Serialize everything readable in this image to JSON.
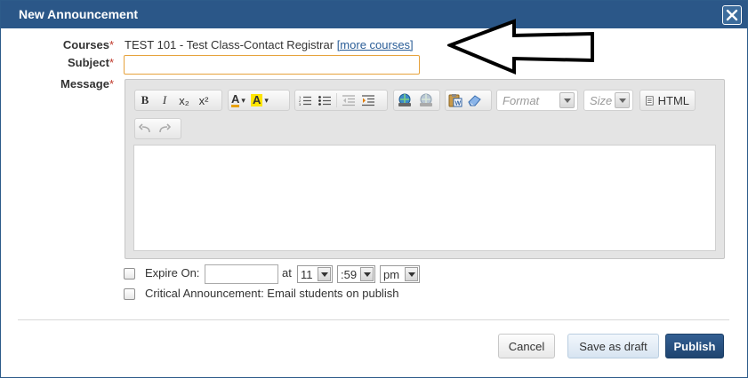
{
  "dialog": {
    "title": "New Announcement",
    "close_icon": "close-icon"
  },
  "form": {
    "courses_label": "Courses",
    "subject_label": "Subject",
    "message_label": "Message",
    "required_mark": "*",
    "courses_value": "TEST 101 - Test Class-Contact Registrar",
    "more_courses_link": "[more courses]",
    "subject_value": ""
  },
  "toolbar": {
    "bold": "B",
    "italic": "I",
    "subscript": "x₂",
    "superscript": "x²",
    "font_color": "A",
    "bg_color": "A",
    "format_placeholder": "Format",
    "size_placeholder": "Size",
    "html_label": "HTML",
    "icons": [
      "bold-icon",
      "italic-icon",
      "subscript-icon",
      "superscript-icon",
      "text-color-icon",
      "background-color-icon",
      "numbered-list-icon",
      "bulleted-list-icon",
      "outdent-icon",
      "indent-icon",
      "link-icon",
      "unlink-icon",
      "paste-word-icon",
      "eraser-icon",
      "source-icon",
      "undo-icon",
      "redo-icon"
    ]
  },
  "options": {
    "expire_label": "Expire On:",
    "at_label": "at",
    "hour": "11",
    "minute": ":59",
    "ampm": "pm",
    "critical_label": "Critical Announcement: Email students on publish"
  },
  "buttons": {
    "cancel": "Cancel",
    "draft": "Save as draft",
    "publish": "Publish"
  },
  "colors": {
    "titlebar": "#2b5788",
    "publish": "#2b5788",
    "required": "#c0392b",
    "link": "#2a5d97"
  }
}
